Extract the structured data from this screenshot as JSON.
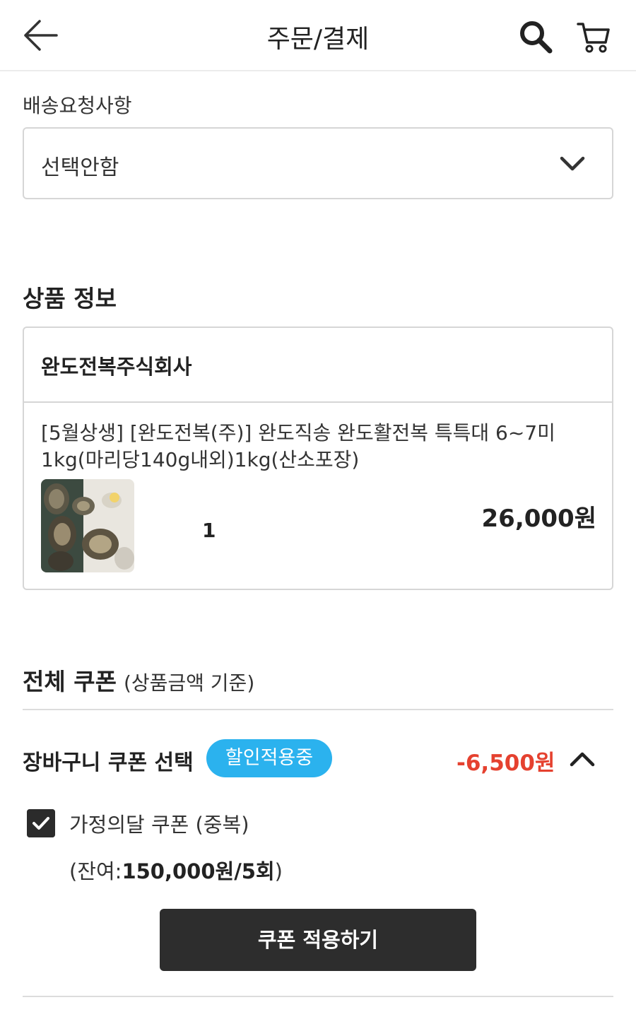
{
  "header": {
    "title": "주문/결제",
    "back_icon": "arrow-left-icon",
    "search_icon": "search-icon",
    "cart_icon": "cart-icon"
  },
  "delivery": {
    "label": "배송요청사항",
    "selected": "선택안함",
    "icon": "chevron-down-icon"
  },
  "product": {
    "section_title": "상품 정보",
    "seller": "완도전복주식회사",
    "name": "[5월상생] [완도전복(주)] 완도직송 완도활전복 특특대 6~7미 1kg(마리당140g내외)1kg(산소포장)",
    "quantity": "1",
    "price": "26,000원"
  },
  "coupon": {
    "title": "전체 쿠폰",
    "subtitle": "(상품금액 기준)",
    "cart_coupon_label": "장바구니 쿠폰 선택",
    "badge": "할인적용중",
    "discount": "-6,500원",
    "item_name": "가정의달 쿠폰 (중복)",
    "item_checked": true,
    "remain_prefix": "(잔여:",
    "remain_value": "150,000원/5회",
    "remain_suffix": ")",
    "apply_button": "쿠폰 적용하기"
  },
  "colors": {
    "badge": "#2bb2ee",
    "discount": "#e5412f",
    "button": "#2d2d2d"
  }
}
